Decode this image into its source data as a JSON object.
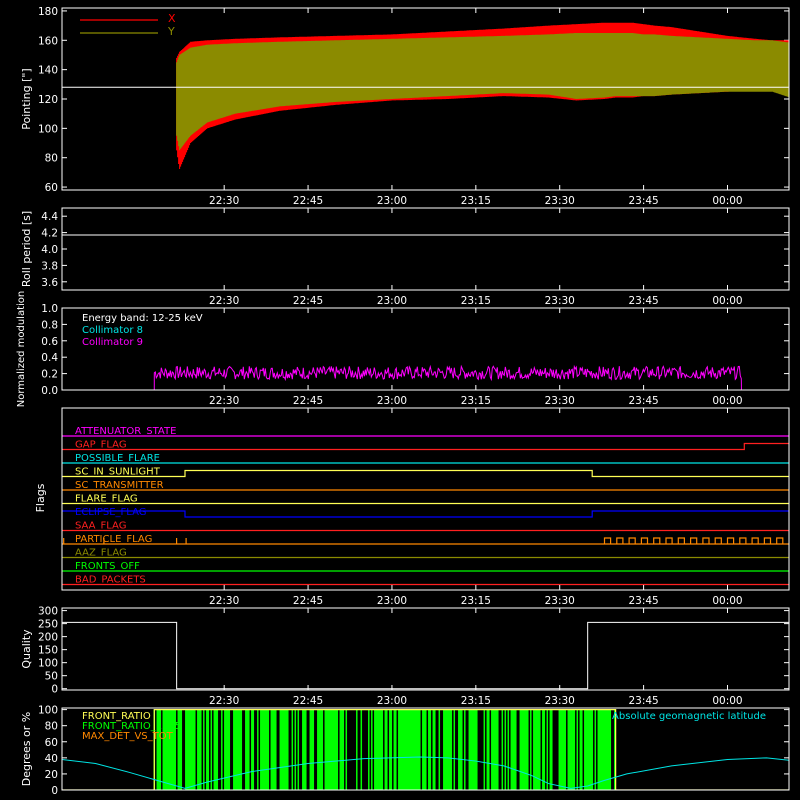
{
  "x_axis": {
    "range": [
      1321,
      1451
    ],
    "ticks": [
      1350,
      1365,
      1380,
      1395,
      1410,
      1425,
      1440
    ],
    "tick_labels": [
      "22:30",
      "22:45",
      "23:00",
      "23:15",
      "23:30",
      "23:45",
      "00:00"
    ]
  },
  "colors": {
    "red": "#ff0000",
    "olive": "#8b8b00",
    "white": "#ffffff",
    "cyan": "#00e5e5",
    "magenta": "#ff00ff",
    "orange": "#ff8800",
    "yellow": "#ffff55",
    "blue": "#0000ff",
    "green": "#00ff00",
    "crimson": "#ff2020",
    "lime": "#00ff00"
  },
  "chart_data": [
    {
      "type": "line",
      "ylabel": "Pointing [\"]",
      "ylim": [
        58,
        182
      ],
      "yticks": [
        60,
        80,
        100,
        120,
        140,
        160,
        180
      ],
      "legend": "top-left",
      "reference_line": 128,
      "series": [
        {
          "name": "X",
          "color": "#ff0000",
          "x": [
            1341.5,
            1342,
            1344,
            1347,
            1352,
            1360,
            1370,
            1380,
            1390,
            1400,
            1408,
            1413,
            1418,
            1420,
            1423,
            1425,
            1427,
            1430,
            1435,
            1440,
            1445,
            1448,
            1452
          ],
          "upper": [
            148,
            152,
            159,
            160,
            161,
            162,
            163,
            164,
            166,
            168,
            170,
            171,
            172,
            172,
            172,
            171,
            170,
            169,
            166,
            163,
            161,
            160,
            160
          ],
          "lower": [
            85,
            72,
            90,
            100,
            106,
            112,
            116,
            119,
            120,
            122,
            121,
            119,
            120,
            121,
            121,
            122,
            122,
            123,
            124,
            125,
            126,
            127,
            127
          ]
        },
        {
          "name": "Y",
          "color": "#8b8b00",
          "x": [
            1341.5,
            1342,
            1344,
            1347,
            1352,
            1360,
            1370,
            1380,
            1390,
            1400,
            1408,
            1413,
            1418,
            1420,
            1423,
            1425,
            1427,
            1430,
            1435,
            1440,
            1445,
            1448,
            1452
          ],
          "upper": [
            145,
            150,
            155,
            157,
            158,
            159,
            160,
            161,
            162,
            163,
            164,
            165,
            165,
            165,
            165,
            164,
            164,
            163,
            162,
            161,
            160,
            160,
            158
          ],
          "lower": [
            95,
            85,
            95,
            104,
            110,
            115,
            118,
            120,
            122,
            124,
            123,
            120,
            121,
            122,
            122,
            122,
            122,
            123,
            124,
            125,
            125,
            125,
            120
          ]
        }
      ]
    },
    {
      "type": "line",
      "ylabel": "Roll period [s]",
      "ylim": [
        3.5,
        4.5
      ],
      "yticks": [
        3.6,
        3.8,
        4.0,
        4.2,
        4.4
      ],
      "tick_labels": [
        "3.6",
        "3.8",
        "4.0",
        "4.2",
        "4.4"
      ],
      "series": [
        {
          "name": "",
          "color": "#ffffff",
          "x": [
            1321,
            1451
          ],
          "y": [
            4.17,
            4.17
          ]
        }
      ]
    },
    {
      "type": "line",
      "ylabel": "Normalized modulation",
      "ylim": [
        0,
        1
      ],
      "yticks": [
        0.0,
        0.2,
        0.4,
        0.6,
        0.8,
        1.0
      ],
      "tick_labels": [
        "0.0",
        "0.2",
        "0.4",
        "0.6",
        "0.8",
        "1.0"
      ],
      "legend_title": "Energy band: 12-25 keV",
      "series": [
        {
          "name": "Collimator 8",
          "color": "#00e5e5",
          "x": [
            1321,
            1451
          ],
          "y": [
            0,
            0
          ]
        },
        {
          "name": "Collimator 9",
          "color": "#ff00ff",
          "x_range": [
            1337.5,
            1442.5
          ],
          "level": 0.21,
          "jitter": 0.08
        }
      ]
    },
    {
      "type": "line",
      "ylabel": "Flags",
      "flags": [
        {
          "name": "ATTENUATOR_STATE",
          "color": "#ff00ff",
          "segments": [
            [
              1321,
              1451,
              0
            ]
          ]
        },
        {
          "name": "GAP_FLAG",
          "color": "#ff2020",
          "segments": [
            [
              1321,
              1443,
              0
            ],
            [
              1443,
              1451,
              1
            ]
          ]
        },
        {
          "name": "POSSIBLE_FLARE",
          "color": "#00e5e5",
          "segments": [
            [
              1321,
              1451,
              0
            ]
          ]
        },
        {
          "name": "SC_IN_SUNLIGHT",
          "color": "#ffff55",
          "segments": [
            [
              1321,
              1343,
              0
            ],
            [
              1343,
              1415.8,
              1
            ],
            [
              1415.8,
              1451,
              0
            ]
          ]
        },
        {
          "name": "SC_TRANSMITTER",
          "color": "#ff8800",
          "segments": [
            [
              1321,
              1451,
              0
            ]
          ]
        },
        {
          "name": "FLARE_FLAG",
          "color": "#ffff55",
          "segments": [
            [
              1321,
              1451,
              0
            ]
          ]
        },
        {
          "name": "ECLIPSE_FLAG",
          "color": "#0000ff",
          "segments": [
            [
              1321,
              1343,
              1
            ],
            [
              1343,
              1415.8,
              0
            ],
            [
              1415.8,
              1451,
              1
            ]
          ]
        },
        {
          "name": "SAA_FLAG",
          "color": "#ff2020",
          "segments": [
            [
              1321,
              1451,
              0
            ]
          ]
        },
        {
          "name": "PARTICLE_FLAG",
          "color": "#ff8800",
          "segments": [
            [
              1321,
              1451,
              0
            ]
          ]
        },
        {
          "name": "AAZ_FLAG",
          "color": "#8b8b00",
          "segments": [
            [
              1321,
              1451,
              0
            ]
          ]
        },
        {
          "name": "FRONTS_OFF",
          "color": "#00ff00",
          "segments": [
            [
              1321,
              1451,
              0
            ]
          ]
        },
        {
          "name": "BAD_PACKETS",
          "color": "#ff2020",
          "segments": [
            [
              1321,
              1451,
              0
            ]
          ]
        }
      ]
    },
    {
      "type": "line",
      "ylabel": "Quality",
      "ylim": [
        -5,
        310
      ],
      "yticks": [
        0,
        50,
        100,
        150,
        200,
        250,
        300
      ],
      "series": [
        {
          "name": "",
          "color": "#ffffff",
          "x": [
            1321,
            1341.5,
            1341.5,
            1415,
            1415,
            1451
          ],
          "y": [
            255,
            255,
            0,
            0,
            255,
            255
          ]
        }
      ]
    },
    {
      "type": "line",
      "ylabel": "Degrees or %",
      "ylim": [
        0,
        102
      ],
      "yticks": [
        0,
        20,
        40,
        60,
        80,
        100
      ],
      "legend": "top-left",
      "series": [
        {
          "name": "FRONT_RATIO",
          "color": "#ffff55",
          "x": [
            1321,
            1337.5,
            1337.5,
            1420,
            1420,
            1451
          ],
          "y": [
            0,
            0,
            100,
            100,
            0,
            0
          ]
        },
        {
          "name": "FRONT_RATIO_1225",
          "color": "#00ff00",
          "x_range": [
            1337.5,
            1420
          ],
          "level": 100
        },
        {
          "name": "MAX_DET_VS_TOT",
          "color": "#ff8800",
          "x": [
            1321,
            1451
          ],
          "y": [
            0,
            0
          ]
        },
        {
          "name": "Absolute geomagnetic latitude",
          "color": "#00e5e5",
          "x": [
            1321,
            1327,
            1333,
            1339,
            1343,
            1347,
            1355,
            1365,
            1375,
            1385,
            1390,
            1395,
            1400,
            1405,
            1408,
            1412,
            1415,
            1418,
            1422,
            1430,
            1440,
            1447,
            1451
          ],
          "y": [
            38,
            33,
            22,
            10,
            2,
            10,
            23,
            33,
            39,
            41,
            40,
            36,
            30,
            18,
            8,
            2,
            5,
            12,
            20,
            30,
            38,
            40,
            37
          ]
        }
      ]
    }
  ]
}
